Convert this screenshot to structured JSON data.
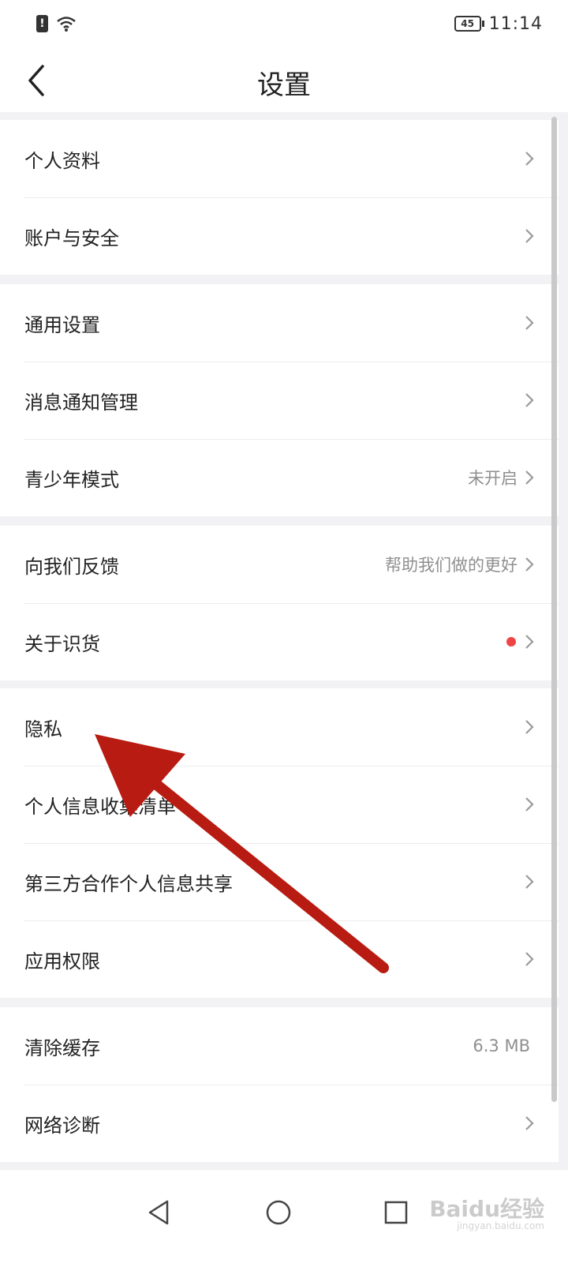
{
  "status_bar": {
    "time": "11:14",
    "battery": "45"
  },
  "nav": {
    "title": "设置"
  },
  "groups": [
    {
      "items": [
        {
          "label": "个人资料",
          "value": ""
        },
        {
          "label": "账户与安全",
          "value": ""
        }
      ]
    },
    {
      "items": [
        {
          "label": "通用设置",
          "value": ""
        },
        {
          "label": "消息通知管理",
          "value": ""
        },
        {
          "label": "青少年模式",
          "value": "未开启"
        }
      ]
    },
    {
      "items": [
        {
          "label": "向我们反馈",
          "value": "帮助我们做的更好"
        },
        {
          "label": "关于识货",
          "value": "",
          "badge": "red-dot"
        }
      ]
    },
    {
      "items": [
        {
          "label": "隐私",
          "value": ""
        },
        {
          "label": "个人信息收集清单",
          "value": ""
        },
        {
          "label": "第三方合作个人信息共享",
          "value": ""
        },
        {
          "label": "应用权限",
          "value": ""
        }
      ]
    },
    {
      "items": [
        {
          "label": "清除缓存",
          "value": "6.3 MB"
        },
        {
          "label": "网络诊断",
          "value": ""
        }
      ]
    }
  ],
  "watermark": {
    "logo": "Baidu经验",
    "sub": "jingyan.baidu.com"
  },
  "icons": {
    "back": "chevron-left-icon",
    "row_arrow": "chevron-right-icon",
    "nav_back": "triangle-back-icon",
    "nav_home": "circle-home-icon",
    "nav_recents": "square-recents-icon"
  },
  "colors": {
    "annotation_arrow": "#b81b12",
    "badge": "#ef4444",
    "divider_bg": "#f2f2f4"
  }
}
